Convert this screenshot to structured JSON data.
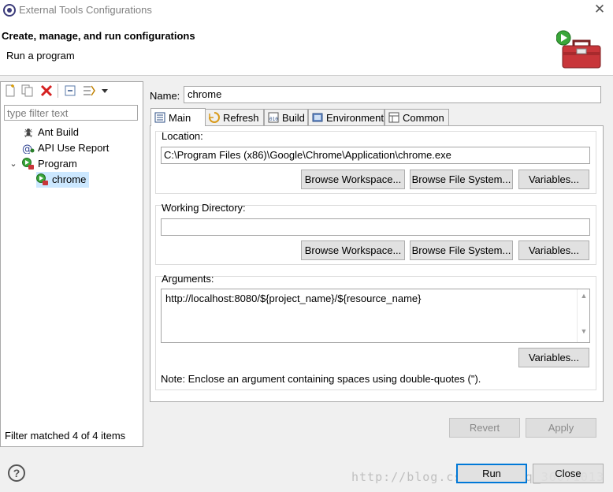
{
  "window": {
    "title": "External Tools Configurations",
    "close_glyph": "✕"
  },
  "header": {
    "title": "Create, manage, and run configurations",
    "subtitle": "Run a program",
    "icon": "toolbox-run-icon"
  },
  "left_panel": {
    "toolbar": [
      {
        "name": "new-configuration-icon"
      },
      {
        "name": "duplicate-icon"
      },
      {
        "name": "delete-icon"
      },
      {
        "name": "collapse-all-icon"
      },
      {
        "name": "filter-icon"
      },
      {
        "name": "view-menu-chevron-icon"
      }
    ],
    "filter_placeholder": "type filter text",
    "tree": [
      {
        "label": "Ant Build",
        "icon": "ant-icon",
        "level": 1
      },
      {
        "label": "API Use Report",
        "icon": "api-report-icon",
        "level": 1
      },
      {
        "label": "Program",
        "icon": "program-icon",
        "level": 1,
        "expanded": true,
        "expander": "⌄"
      },
      {
        "label": "chrome",
        "icon": "program-config-icon",
        "level": 2,
        "selected": true
      }
    ],
    "status": "Filter matched 4 of 4 items"
  },
  "config": {
    "name_label": "Name:",
    "name_value": "chrome",
    "tabs": [
      {
        "label": "Main",
        "icon": "main-tab-icon",
        "active": true
      },
      {
        "label": "Refresh",
        "icon": "refresh-tab-icon"
      },
      {
        "label": "Build",
        "icon": "build-tab-icon"
      },
      {
        "label": "Environment",
        "icon": "environment-tab-icon"
      },
      {
        "label": "Common",
        "icon": "common-tab-icon"
      }
    ],
    "location": {
      "label": "Location:",
      "value": "C:\\Program Files (x86)\\Google\\Chrome\\Application\\chrome.exe",
      "browse_workspace": "Browse Workspace...",
      "browse_file_system": "Browse File System...",
      "variables": "Variables..."
    },
    "working_directory": {
      "label": "Working Directory:",
      "value": "",
      "browse_workspace": "Browse Workspace...",
      "browse_file_system": "Browse File System...",
      "variables": "Variables..."
    },
    "arguments": {
      "label": "Arguments:",
      "value": "http://localhost:8080/${project_name}/${resource_name}",
      "variables": "Variables...",
      "note": "Note: Enclose an argument containing spaces using double-quotes (\")."
    },
    "revert": "Revert",
    "apply": "Apply"
  },
  "footer": {
    "help": "?",
    "run": "Run",
    "close": "Close",
    "watermark": "http://blog.csdn.net/qq_36071013"
  },
  "colors": {
    "selection": "#cce8ff",
    "default_button_border": "#0078d7"
  }
}
